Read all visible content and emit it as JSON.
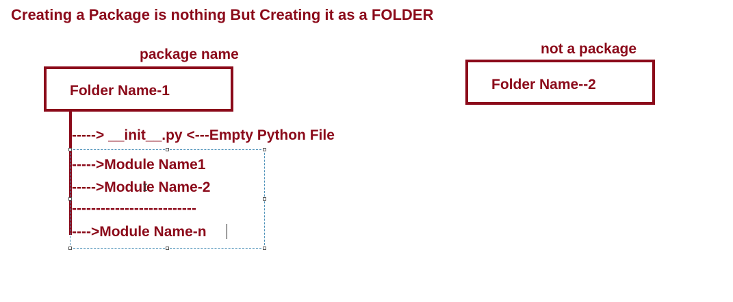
{
  "title": "Creating a Package is nothing But Creating it as a FOLDER",
  "package_label": "package name",
  "not_package_label": "not a package",
  "folder1": "Folder Name-1",
  "folder2": "Folder Name--2",
  "lines": [
    "-----> __init__.py <---Empty Python File",
    "----->Module Name1",
    "----->Module Name-2",
    "--------------------------",
    "---->Module Name-n"
  ],
  "colors": {
    "accent": "#8b0a1a",
    "selection": "#4a90b8"
  }
}
